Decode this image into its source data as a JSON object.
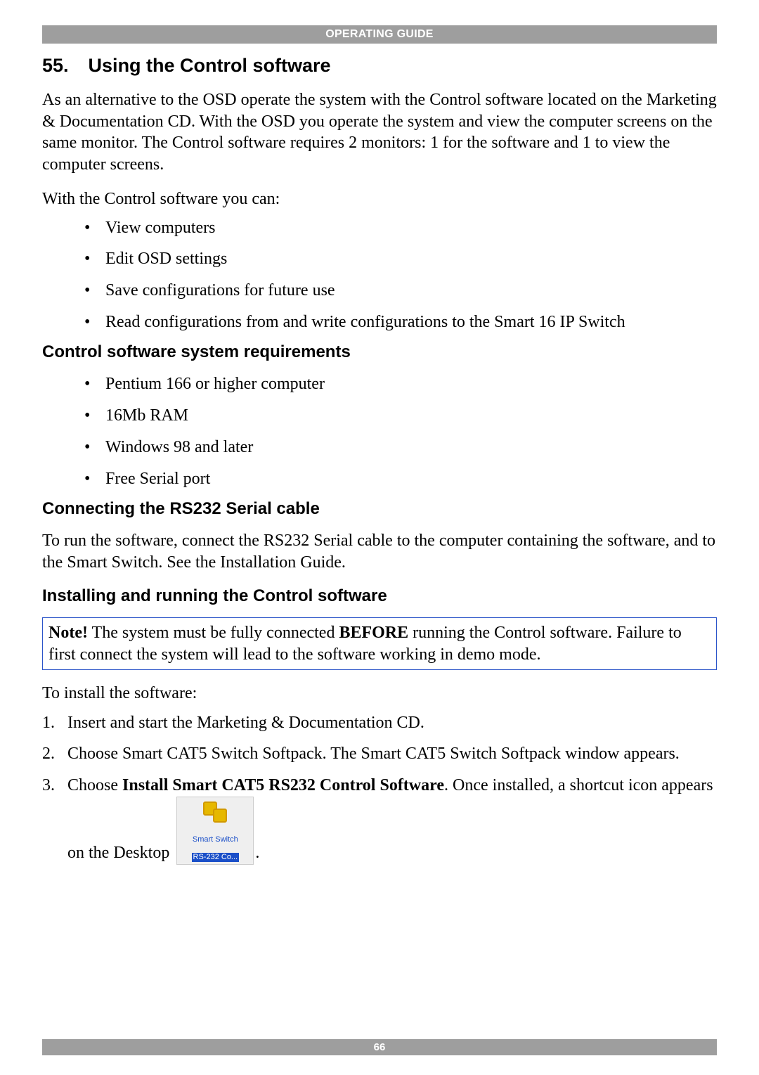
{
  "banner": "OPERATING GUIDE",
  "section": {
    "number": "55.",
    "title": "Using the Control software"
  },
  "para1": "As an alternative to the OSD operate the system with the Control software located on the Marketing & Documentation CD. With the OSD you operate the system and view the computer screens on the same monitor. The Control software requires 2 monitors: 1 for the software and 1 to view the computer screens.",
  "para2": "With the Control software you can:",
  "bullets1": [
    "View computers",
    "Edit OSD settings",
    "Save configurations for future use",
    "Read configurations from and write configurations to the Smart 16 IP Switch"
  ],
  "h2a": "Control software system requirements",
  "bullets2": [
    "Pentium 166 or higher computer",
    "16Mb RAM",
    "Windows 98 and later",
    "Free Serial port"
  ],
  "h2b": "Connecting the RS232 Serial cable",
  "para3": "To run the software, connect the RS232 Serial cable to the computer containing the software, and to the Smart Switch. See the Installation Guide.",
  "h2c": "Installing and running the Control software",
  "note": {
    "label": "Note!",
    "before_bold": " The system must be fully connected ",
    "bold": "BEFORE",
    "after_bold": " running the Control software. Failure to first connect the system will lead to the software working in demo mode."
  },
  "para4": "To install the software:",
  "steps": {
    "s1": "Insert and start the Marketing & Documentation CD.",
    "s2": "Choose Smart CAT5 Switch Softpack. The Smart CAT5 Switch Softpack window appears.",
    "s3_prefix": "Choose ",
    "s3_bold": "Install Smart CAT5 RS232 Control Software",
    "s3_middle": ". Once installed, a shortcut icon appears on the Desktop ",
    "s3_suffix": "."
  },
  "icon": {
    "line1": "Smart Switch",
    "line2": "RS-232 Co..."
  },
  "page_number": "66"
}
